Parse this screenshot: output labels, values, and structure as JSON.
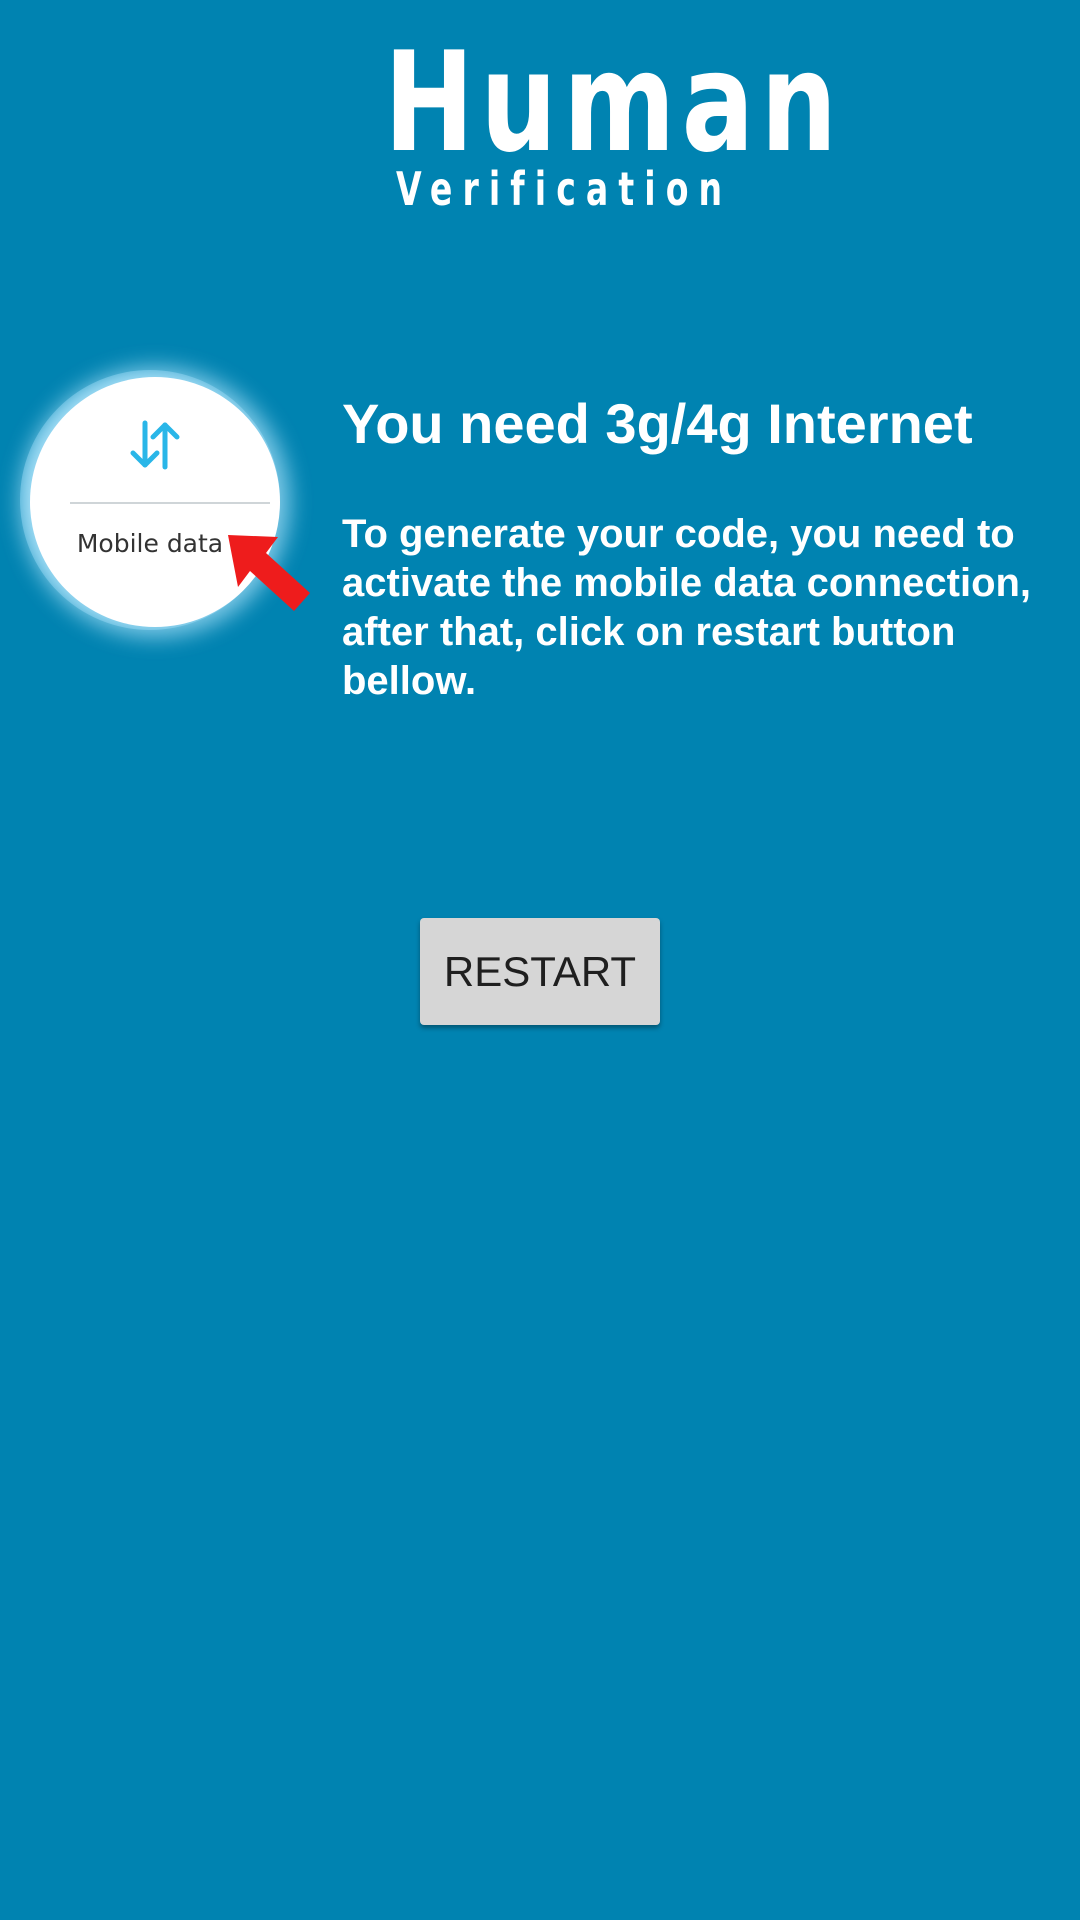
{
  "logo": {
    "title": "Human",
    "subtitle": "Verification"
  },
  "illustration": {
    "label": "Mobile data",
    "icon": "data-arrows-icon",
    "pointer_icon": "red-arrow-icon",
    "pointer_color": "#ee1c1c",
    "icon_color": "#29b6e8"
  },
  "main": {
    "heading": "You need 3g/4g Internet",
    "message": "To generate your code, you need to activate the mobile data connection, after that, click on restart button bellow."
  },
  "actions": {
    "restart_label": "RESTART"
  },
  "colors": {
    "background": "#0083b1",
    "text": "#ffffff",
    "button": "#d6d6d6",
    "button_text": "#1f1f1f"
  }
}
